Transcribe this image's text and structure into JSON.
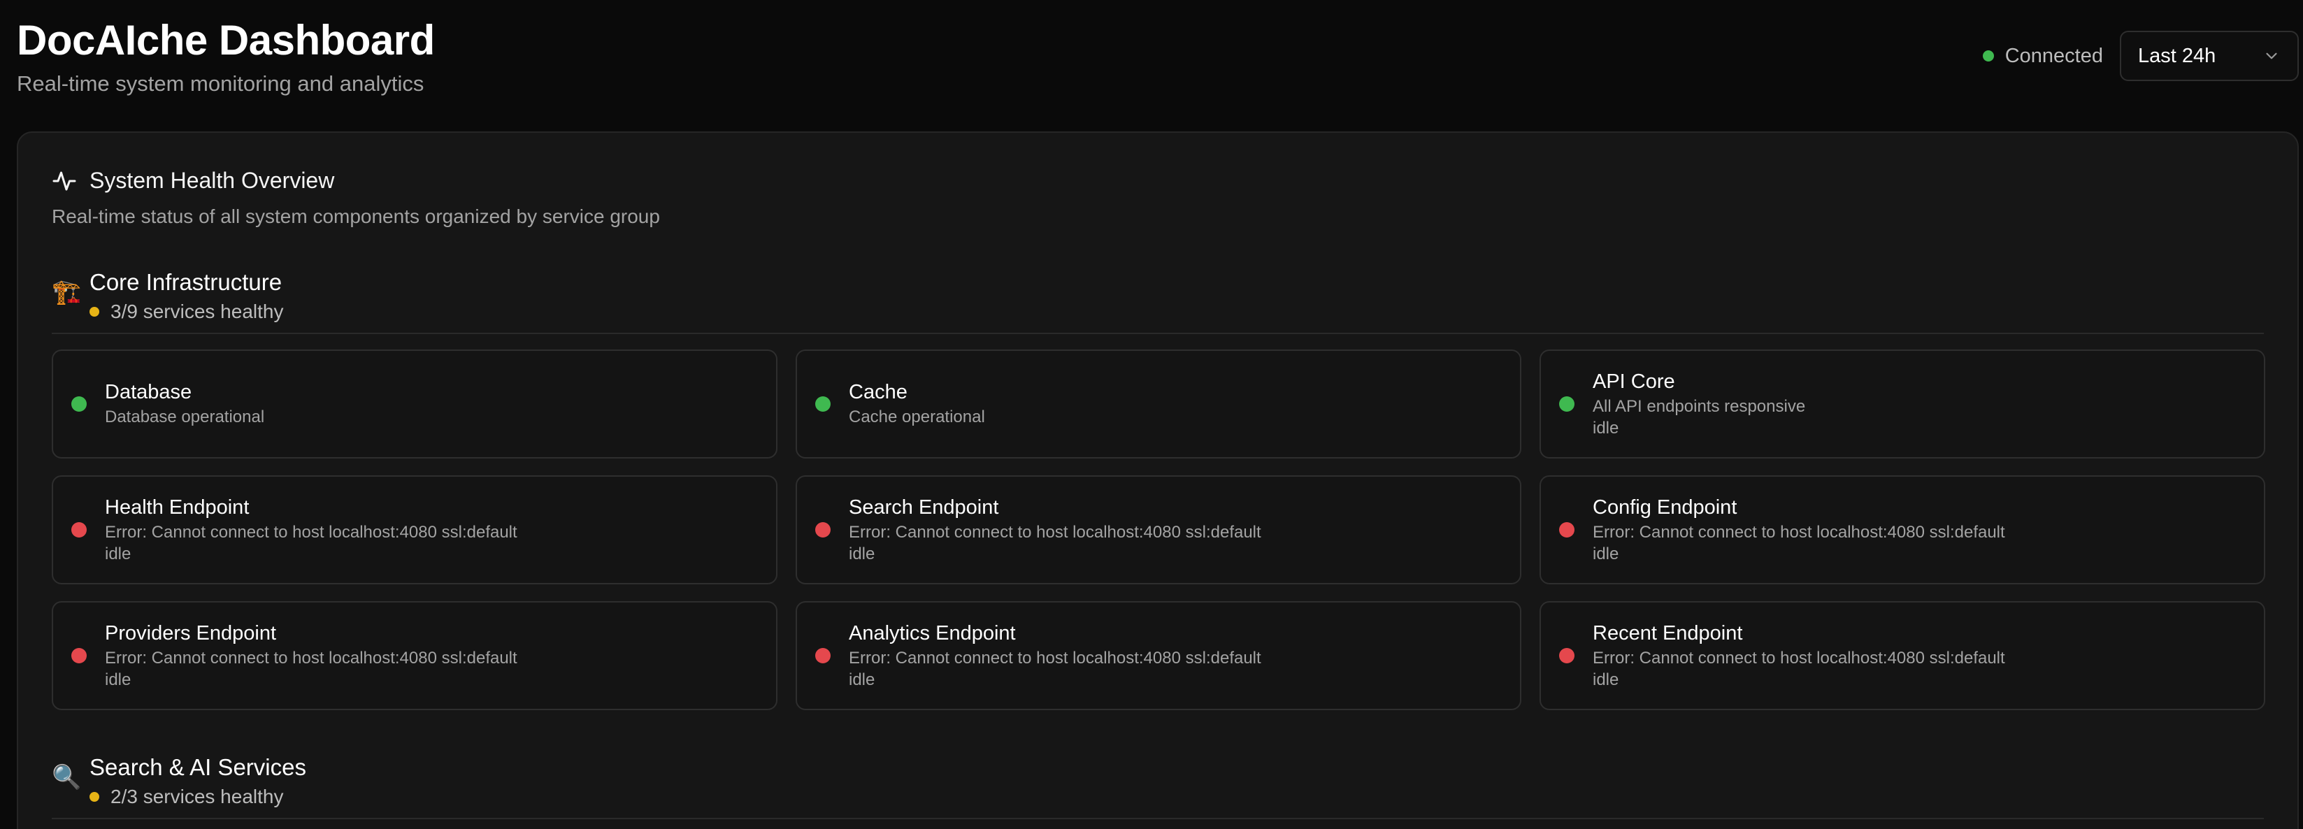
{
  "header": {
    "title": "DocAIche Dashboard",
    "subtitle": "Real-time system monitoring and analytics"
  },
  "connection": {
    "label": "Connected",
    "color": "#3fb950"
  },
  "time_range": {
    "selected": "Last 24h",
    "icon": "chevron-down-icon"
  },
  "overview": {
    "icon": "activity-pulse-icon",
    "title": "System Health Overview",
    "description": "Real-time status of all system components organized by service group"
  },
  "sections": [
    {
      "icon": "🏗️",
      "title": "Core Infrastructure",
      "status": "3/9 services healthy",
      "status_color": "#e7b416",
      "services": [
        {
          "name": "Database",
          "message": "Database operational",
          "state": "",
          "status": "healthy"
        },
        {
          "name": "Cache",
          "message": "Cache operational",
          "state": "",
          "status": "healthy"
        },
        {
          "name": "API Core",
          "message": "All API endpoints responsive",
          "state": "idle",
          "status": "healthy"
        },
        {
          "name": "Health Endpoint",
          "message": "Error: Cannot connect to host localhost:4080 ssl:default",
          "state": "idle",
          "status": "error"
        },
        {
          "name": "Search Endpoint",
          "message": "Error: Cannot connect to host localhost:4080 ssl:default",
          "state": "idle",
          "status": "error"
        },
        {
          "name": "Config Endpoint",
          "message": "Error: Cannot connect to host localhost:4080 ssl:default",
          "state": "idle",
          "status": "error"
        },
        {
          "name": "Providers Endpoint",
          "message": "Error: Cannot connect to host localhost:4080 ssl:default",
          "state": "idle",
          "status": "error"
        },
        {
          "name": "Analytics Endpoint",
          "message": "Error: Cannot connect to host localhost:4080 ssl:default",
          "state": "idle",
          "status": "error"
        },
        {
          "name": "Recent Endpoint",
          "message": "Error: Cannot connect to host localhost:4080 ssl:default",
          "state": "idle",
          "status": "error"
        }
      ]
    },
    {
      "icon": "🔍",
      "title": "Search & AI Services",
      "status": "2/3 services healthy",
      "status_color": "#e7b416",
      "services": []
    }
  ],
  "colors": {
    "healthy": "#3fb950",
    "error": "#e5484d",
    "warning": "#e7b416"
  }
}
